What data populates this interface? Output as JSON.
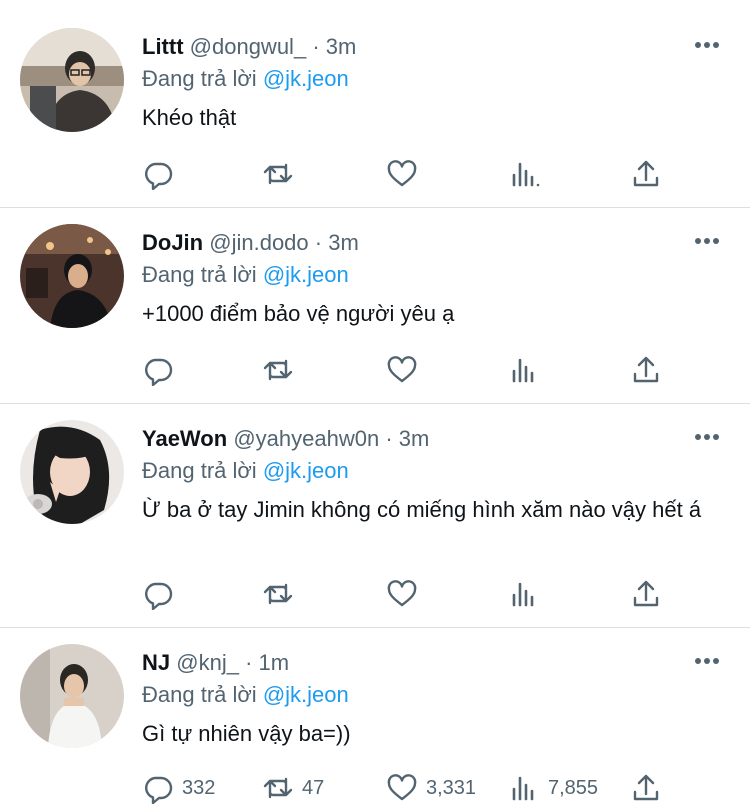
{
  "tweets": [
    {
      "name": "Littt",
      "handle": "@dongwul_",
      "separator": "·",
      "time": "3m",
      "reply_prefix": "Đang trả lời",
      "reply_to": "@jk.jeon",
      "text": "Khéo thật",
      "counts": {
        "reply": "",
        "retweet": "",
        "like": "",
        "views": ""
      },
      "avatar_colors": {
        "bg": "#b9aa97",
        "fg": "#3b3634",
        "accent": "#d9cfc2"
      }
    },
    {
      "name": "DoJin",
      "handle": "@jin.dodo",
      "separator": "·",
      "time": "3m",
      "reply_prefix": "Đang trả lời",
      "reply_to": "@jk.jeon",
      "text": "+1000 điểm bảo vệ người yêu ạ",
      "counts": {
        "reply": "",
        "retweet": "",
        "like": "",
        "views": ""
      },
      "avatar_colors": {
        "bg": "#5a3d30",
        "fg": "#17171a",
        "accent": "#d8a07a"
      }
    },
    {
      "name": "YaeWon",
      "handle": "@yahyeahw0n",
      "separator": "·",
      "time": "3m",
      "reply_prefix": "Đang trả lời",
      "reply_to": "@jk.jeon",
      "text": "Ừ ba ở tay Jimin không có miếng hình xăm nào vậy hết á",
      "counts": {
        "reply": "",
        "retweet": "",
        "like": "",
        "views": ""
      },
      "avatar_colors": {
        "bg": "#e9e6e3",
        "fg": "#222222",
        "accent": "#f2c9b8"
      }
    },
    {
      "name": "NJ",
      "handle": "@knj_",
      "separator": "·",
      "time": "1m",
      "reply_prefix": "Đang trả lời",
      "reply_to": "@jk.jeon",
      "text": "Gì tự nhiên vậy ba=))",
      "counts": {
        "reply": "332",
        "retweet": "47",
        "like": "3,331",
        "views": "7,855"
      },
      "avatar_colors": {
        "bg": "#cfc8c0",
        "fg": "#f4f4f2",
        "accent": "#2a2624"
      }
    }
  ],
  "icons": [
    "reply-icon",
    "retweet-icon",
    "like-icon",
    "views-icon",
    "share-icon",
    "more-icon"
  ],
  "colors": {
    "text": "#0f1419",
    "muted": "#536471",
    "link": "#1d9bf0",
    "divider": "#dcdfe3"
  }
}
